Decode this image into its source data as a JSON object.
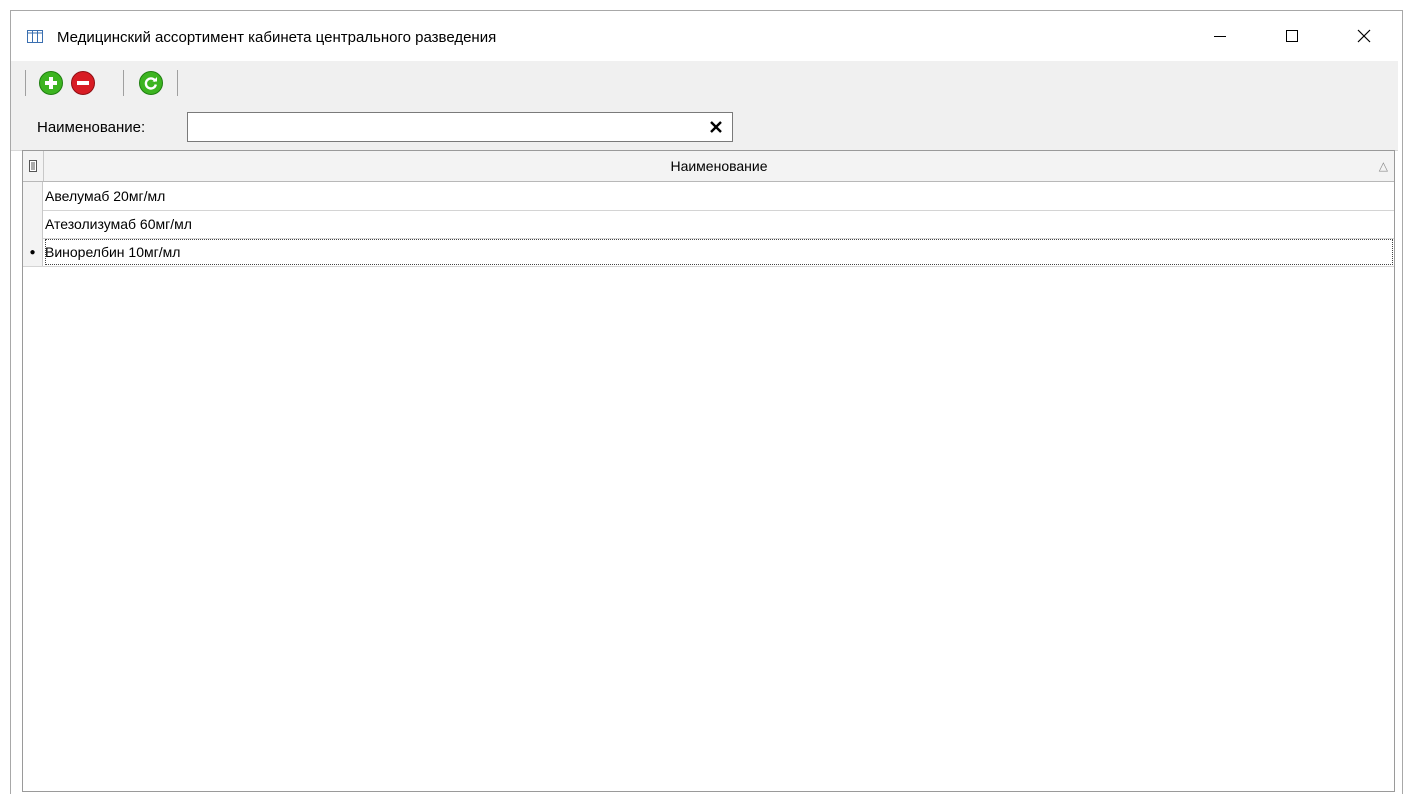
{
  "window": {
    "title": "Медицинский ассортимент кабинета центрального разведения",
    "icon": "table-icon"
  },
  "toolbar": {
    "buttons": [
      {
        "icon": "add-icon",
        "color": "#3cb420"
      },
      {
        "icon": "remove-icon",
        "color": "#d81c24"
      },
      {
        "icon": "refresh-icon",
        "color": "#3cb420"
      }
    ]
  },
  "filter": {
    "label": "Наименование:",
    "value": "",
    "clear_icon": "close-icon"
  },
  "grid": {
    "column": "Наименование",
    "sort": "ascending",
    "rows": [
      {
        "name": "Авелумаб 20мг/мл",
        "current": false
      },
      {
        "name": "Атезолизумаб 60мг/мл",
        "current": false
      },
      {
        "name": "Винорелбин 10мг/мл",
        "current": true
      }
    ]
  }
}
